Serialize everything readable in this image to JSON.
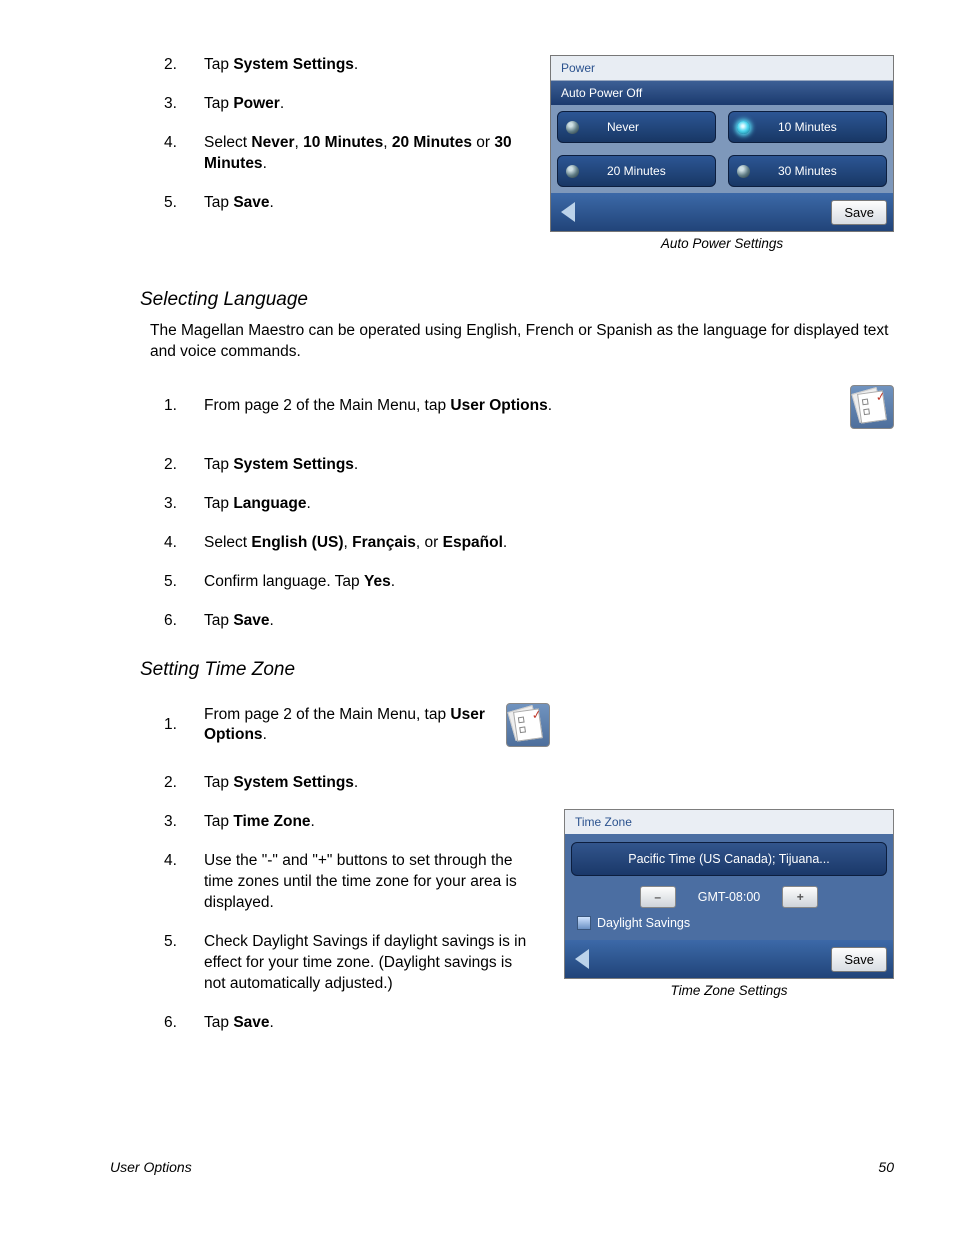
{
  "powerSteps": [
    {
      "n": "2.",
      "pre": "Tap ",
      "b": "System Settings",
      "post": "."
    },
    {
      "n": "3.",
      "pre": "Tap ",
      "b": "Power",
      "post": "."
    },
    {
      "n": "4.",
      "pre": "Select ",
      "multi": [
        "Never",
        ", ",
        "10 Minutes",
        ", ",
        "20 Minutes",
        " or ",
        "30 Minutes",
        "."
      ]
    },
    {
      "n": "5.",
      "pre": "Tap ",
      "b": "Save",
      "post": "."
    }
  ],
  "autoPower": {
    "title": "Power",
    "subtitle": "Auto Power Off",
    "options": [
      "Never",
      "10 Minutes",
      "20 Minutes",
      "30 Minutes"
    ],
    "selected": 1,
    "save": "Save",
    "caption": "Auto Power Settings"
  },
  "lang": {
    "heading": "Selecting Language",
    "intro": "The Magellan Maestro can be operated using English, French or Spanish as the language for displayed text and voice commands.",
    "steps": [
      {
        "n": "1.",
        "pre": "From page 2 of the Main Menu, tap ",
        "b": "User Options",
        "post": ".",
        "icon": true
      },
      {
        "n": "2.",
        "pre": "Tap ",
        "b": "System Settings",
        "post": "."
      },
      {
        "n": "3.",
        "pre": "Tap ",
        "b": "Language",
        "post": "."
      },
      {
        "n": "4.",
        "pre": "Select ",
        "multi": [
          "English (US)",
          ", ",
          "Français",
          ", or ",
          "Español",
          "."
        ]
      },
      {
        "n": "5.",
        "pre": "Confirm language.  Tap ",
        "b": "Yes",
        "post": "."
      },
      {
        "n": "6.",
        "pre": "Tap ",
        "b": "Save",
        "post": "."
      }
    ]
  },
  "tz": {
    "heading": "Setting Time Zone",
    "steps": [
      {
        "n": "1.",
        "pre": "From page 2 of the Main Menu, tap ",
        "b": "User Options",
        "post": ".",
        "icon": true
      },
      {
        "n": "2.",
        "pre": "Tap ",
        "b": "System Settings",
        "post": "."
      },
      {
        "n": "3.",
        "pre": "Tap ",
        "b": "Time Zone",
        "post": "."
      },
      {
        "n": "4.",
        "text": "Use the \"-\" and \"+\" buttons to set through the time zones until the time zone for your area is displayed."
      },
      {
        "n": "5.",
        "text": "Check Daylight Savings if daylight savings is in effect for your time zone.  (Daylight savings is not automatically adjusted.)"
      },
      {
        "n": "6.",
        "pre": "Tap ",
        "b": "Save",
        "post": "."
      }
    ],
    "shot": {
      "title": "Time Zone",
      "zone": "Pacific Time (US  Canada); Tijuana...",
      "minus": "–",
      "plus": "+",
      "gmt": "GMT-08:00",
      "ds": "Daylight Savings",
      "save": "Save",
      "caption": "Time Zone Settings"
    }
  },
  "footer": {
    "left": "User Options",
    "right": "50"
  }
}
